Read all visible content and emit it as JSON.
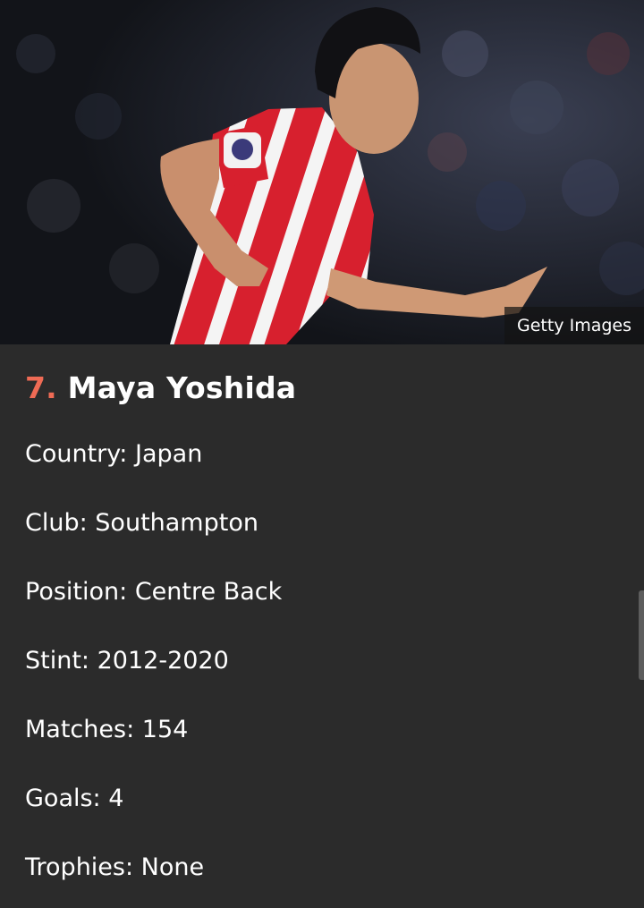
{
  "photo": {
    "icon": "player-photo",
    "credit": "Getty Images"
  },
  "player": {
    "rank": "7.",
    "name": "Maya Yoshida"
  },
  "facts": [
    {
      "label": "Country:",
      "value": "Japan"
    },
    {
      "label": "Club:",
      "value": "Southampton"
    },
    {
      "label": "Position:",
      "value": "Centre Back"
    },
    {
      "label": "Stint:",
      "value": "2012-2020"
    },
    {
      "label": "Matches:",
      "value": "154"
    },
    {
      "label": "Goals:",
      "value": "4"
    },
    {
      "label": "Trophies:",
      "value": "None"
    }
  ],
  "colors": {
    "background": "#2b2b2b",
    "accent": "#ef6b55",
    "text": "#ffffff",
    "kit_red": "#d7202e",
    "kit_white": "#f4f4f4"
  }
}
